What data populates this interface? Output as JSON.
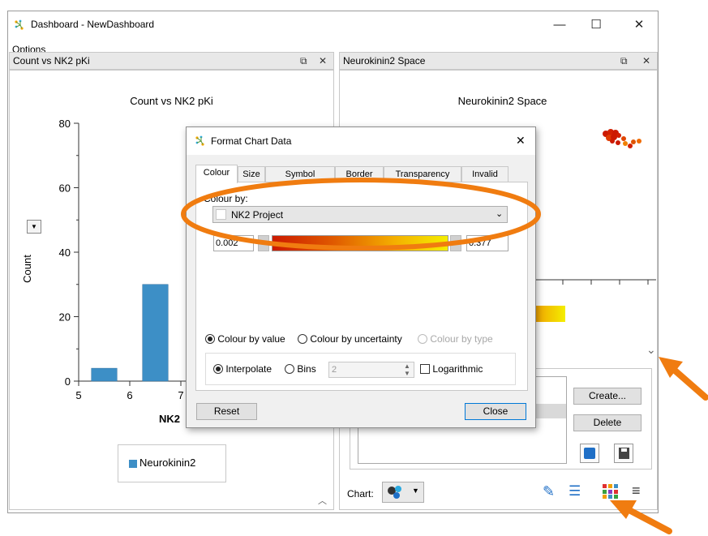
{
  "window": {
    "title": "Dashboard - NewDashboard",
    "menu": [
      "Options"
    ],
    "controls": {
      "minimize": "—",
      "maximize": "☐",
      "close": "✕"
    }
  },
  "left_panel": {
    "header": "Count vs NK2 pKi",
    "chart_title": "Count vs NK2 pKi",
    "legend_label": "Neurokinin2",
    "xlabel_partial": "NK2"
  },
  "right_panel": {
    "header": "Neurokinin2 Space",
    "chart_title": "Neurokinin2 Space",
    "create_button": "Create...",
    "delete_button": "Delete",
    "chart_label": "Chart:"
  },
  "dialog": {
    "title": "Format Chart Data",
    "tabs": [
      "Colour",
      "Size",
      "Symbol",
      "Border",
      "Transparency",
      "Invalid"
    ],
    "active_tab": "Colour",
    "colour_by_label": "Colour by:",
    "colour_by_value": "NK2 Project",
    "range_min": "0.002",
    "range_max": "0.377",
    "mode_options": [
      "Colour by value",
      "Colour by uncertainty",
      "Colour by type"
    ],
    "interpolate_label": "Interpolate",
    "bins_label": "Bins",
    "bins_value": "2",
    "logarithmic_label": "Logarithmic",
    "reset_button": "Reset",
    "close_button": "Close"
  },
  "chart_data": {
    "type": "bar",
    "title": "Count vs NK2 pKi",
    "xlabel": "NK2",
    "ylabel": "Count",
    "x_ticks": [
      "5",
      "6",
      "7"
    ],
    "y_ticks": [
      "0",
      "20",
      "40",
      "60",
      "80"
    ],
    "ylim": [
      0,
      80
    ],
    "xlim": [
      5,
      7.5
    ],
    "bars": [
      {
        "x_start": 5.25,
        "x_end": 5.75,
        "value": 4
      },
      {
        "x_start": 6.25,
        "x_end": 6.75,
        "value": 30
      }
    ],
    "series": [
      {
        "name": "Neurokinin2",
        "color": "#3d8fc6"
      }
    ],
    "legend_position": "bottom"
  },
  "colors": {
    "bar": "#3d8fc6",
    "annotation": "#f07c10",
    "gradient_start": "#cc1a00",
    "gradient_end": "#f4ee00"
  }
}
